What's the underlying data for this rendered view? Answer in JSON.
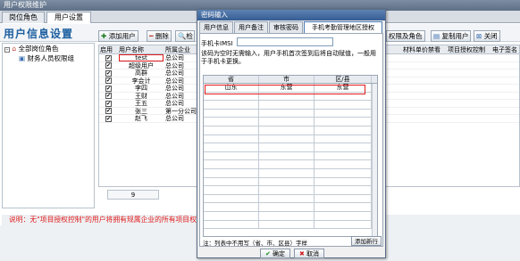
{
  "window": {
    "title": "用户权限维护"
  },
  "main_tabs": [
    {
      "label": "岗位角色"
    },
    {
      "label": "用户设置"
    }
  ],
  "page_title": "用户信息设置",
  "tree": {
    "root": "全部岗位角色",
    "child": "财务人员权限组"
  },
  "toolbar": {
    "add": "添加用户",
    "delete": "删除",
    "check": "检",
    "perm_role": "权限及角色",
    "copy_user": "复制用户",
    "close": "关闭"
  },
  "grid": {
    "headers": {
      "enabled": "启用",
      "username": "用户名称",
      "company": "所属企业"
    },
    "right_headers": [
      "材料单价禁看",
      "项目授权控制",
      "电子签名"
    ],
    "rows": [
      {
        "name": "test",
        "company": "总公司",
        "enabled": true
      },
      {
        "name": "超级用户",
        "company": "总公司",
        "enabled": true
      },
      {
        "name": "高群",
        "company": "总公司",
        "enabled": true
      },
      {
        "name": "李会计",
        "company": "总公司",
        "enabled": true
      },
      {
        "name": "李四",
        "company": "总公司",
        "enabled": true
      },
      {
        "name": "王财",
        "company": "总公司",
        "enabled": true
      },
      {
        "name": "王五",
        "company": "总公司",
        "enabled": true
      },
      {
        "name": "张三",
        "company": "第一分公司",
        "enabled": true
      },
      {
        "name": "赵飞",
        "company": "总公司",
        "enabled": true
      }
    ],
    "count": "9"
  },
  "note": "说明：无\"项目授权控制\"的用户将拥有规属企业的所有项目权",
  "dialog": {
    "title": "密码输入",
    "tabs": [
      "用户信息",
      "用户备注",
      "审核密码",
      "手机考勤管理地区授权"
    ],
    "imsi_label": "手机卡IMSI",
    "imsi_value": "",
    "hint": "该码为空时无需输入，用户手机首次签到后将自动赋值，一般用于手机卡更换。",
    "table_headers": [
      "省",
      "市",
      "区/县"
    ],
    "region_rows": [
      {
        "province": "山东",
        "city": "东营",
        "county": "东营"
      }
    ],
    "footnote": "注：列表中不用写（省、市、区县）字样",
    "add_row": "添加新行",
    "ok": "确定",
    "cancel": "取消"
  }
}
